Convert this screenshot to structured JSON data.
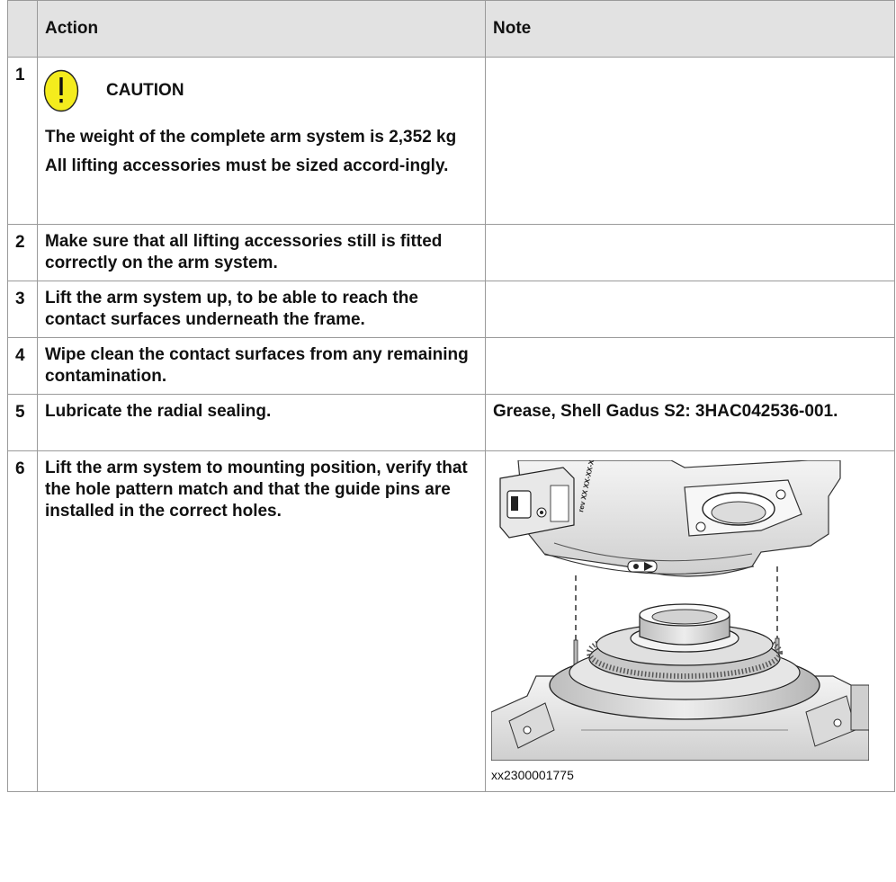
{
  "header": {
    "number": "",
    "action": "Action",
    "note": "Note"
  },
  "steps": [
    {
      "number": "1",
      "caution_title": "CAUTION",
      "caution_line1": "The weight of the complete arm system is 2,352 kg",
      "caution_line2": "All lifting accessories must be sized accord-ingly.",
      "note": ""
    },
    {
      "number": "2",
      "action": "Make sure that all lifting accessories still is fitted correctly on the arm system.",
      "note": ""
    },
    {
      "number": "3",
      "action": "Lift the arm system up, to be able to reach the contact surfaces underneath the frame.",
      "note": ""
    },
    {
      "number": "4",
      "action": "Wipe clean the contact surfaces from any remaining contamination.",
      "note": ""
    },
    {
      "number": "5",
      "action": "Lubricate the radial sealing.",
      "note": "Grease, Shell Gadus S2: 3HAC042536-001."
    },
    {
      "number": "6",
      "action": "Lift the arm system to mounting position, verify that the hole pattern match and that the guide pins are installed in the correct holes.",
      "figure_caption": "xx2300001775",
      "figure_label_text": "rev XX XX-XX-XX"
    }
  ],
  "colors": {
    "header_bg": "#e2e2e2",
    "border": "#9a9a9a",
    "caution_yellow": "#f4ec1d"
  }
}
